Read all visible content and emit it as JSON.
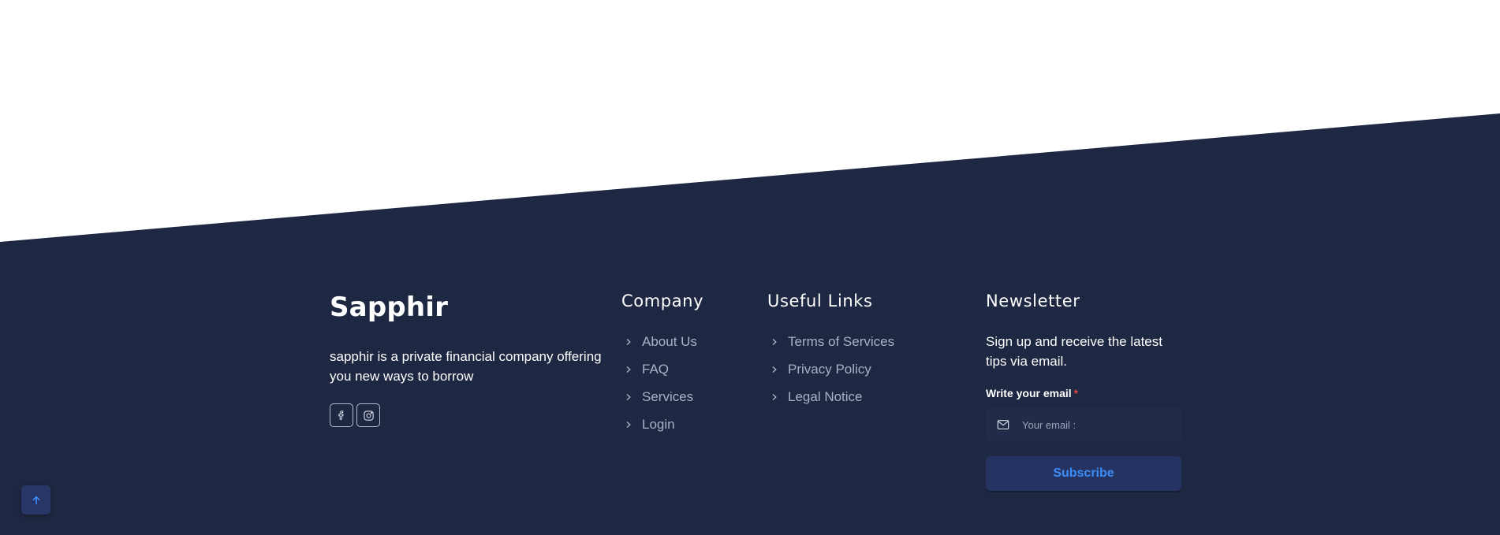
{
  "colors": {
    "footer_background": "#1f2842",
    "page_background": "#ffffff",
    "link_color": "#a9b1c3",
    "accent": "#3c8df7",
    "required_marker": "#e0434a"
  },
  "brand": {
    "name": "Sapphir",
    "description": "sapphir is a private financial company offering you new ways to borrow",
    "social": [
      {
        "icon": "facebook-icon"
      },
      {
        "icon": "instagram-icon"
      }
    ]
  },
  "company": {
    "title": "Company",
    "links": [
      "About Us",
      "FAQ",
      "Services",
      "Login"
    ]
  },
  "useful_links": {
    "title": "Useful Links",
    "links": [
      "Terms of Services",
      "Privacy Policy",
      "Legal Notice"
    ]
  },
  "newsletter": {
    "title": "Newsletter",
    "description": "Sign up and receive the latest tips via email.",
    "email_label": "Write your email",
    "required_mark": "*",
    "email_placeholder": "Your email :",
    "email_icon": "mail-icon",
    "subscribe_label": "Subscribe"
  },
  "scroll_top": {
    "icon": "arrow-up-icon"
  }
}
